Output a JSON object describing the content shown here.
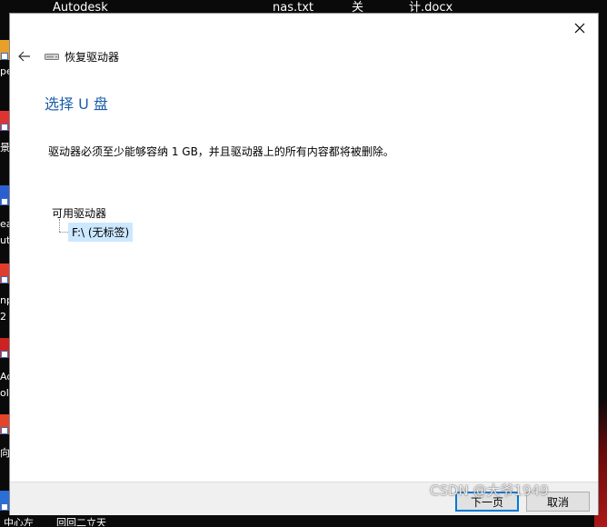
{
  "desktop": {
    "top_items": [
      "Autodesk",
      "nas.txt",
      "关",
      "计.docx"
    ],
    "left_fragments": [
      "pe",
      "景",
      "ea",
      "uto",
      "np",
      "2",
      "Ad",
      "ol",
      "向"
    ],
    "bottom_items": [
      "中心左",
      "回回二立天"
    ]
  },
  "dialog": {
    "wizard_title": "恢复驱动器",
    "heading": "选择 U 盘",
    "description": "驱动器必须至少能够容纳 1 GB，并且驱动器上的所有内容都将被删除。",
    "tree": {
      "root_label": "可用驱动器",
      "items": [
        {
          "label": "F:\\ (无标签)",
          "selected": true
        }
      ]
    },
    "buttons": {
      "next": "下一页",
      "cancel": "取消"
    }
  },
  "watermark": "CSDN @大爷1949",
  "colors": {
    "heading": "#1c5ea8",
    "selection": "#cce8ff",
    "primary_button_border": "#0078d7",
    "footer": "#f0f0f0"
  }
}
